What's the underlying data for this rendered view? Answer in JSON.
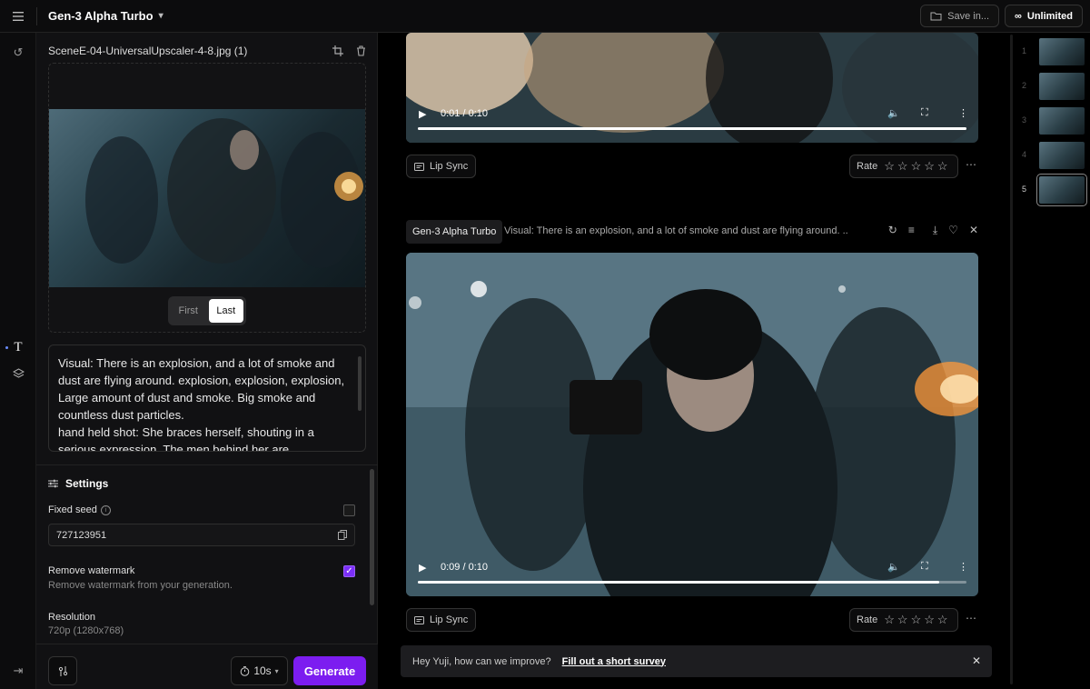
{
  "topbar": {
    "menu_icon": "hamburger-menu-icon",
    "model_name": "Gen-3 Alpha Turbo",
    "save_label": "Save in...",
    "plan_label": "Unlimited"
  },
  "panel": {
    "file_name": "SceneE-04-UniversalUpscaler-4-8.jpg (1)",
    "frame_options": [
      "First",
      "Last"
    ],
    "frame_selected": "Last",
    "prompt": "Visual: There is an explosion, and a lot of smoke and dust are flying around. explosion, explosion, explosion, Large amount of dust and smoke. Big smoke and countless dust particles.\nhand held shot: She braces herself, shouting in a serious expression. The men behind her are",
    "settings": {
      "title": "Settings",
      "fixed_seed_label": "Fixed seed",
      "fixed_seed_checked": false,
      "seed_value": "727123951",
      "watermark_label": "Remove watermark",
      "watermark_sub": "Remove watermark from your generation.",
      "watermark_checked": true,
      "resolution_label": "Resolution",
      "resolution_value": "720p (1280x768)"
    },
    "duration": "10s",
    "generate_label": "Generate"
  },
  "feed": {
    "video1": {
      "time": "0:01 / 0:10",
      "progress": 1.0
    },
    "lip_sync_label": "Lip Sync",
    "rate_label": "Rate",
    "generation": {
      "model": "Gen-3 Alpha Turbo",
      "prompt": "Visual: There is an explosion, and a lot of smoke and dust are flying around. ..."
    },
    "video2": {
      "time": "0:09 / 0:10",
      "progress": 0.95
    }
  },
  "survey": {
    "text": "Hey Yuji, how can we improve?",
    "link": "Fill out a short survey"
  },
  "thumbnails": [
    "1",
    "2",
    "3",
    "4",
    "5"
  ],
  "thumbnail_selected": "5",
  "colors": {
    "accent": "#7c1df0",
    "background": "#000000",
    "panel": "#111113"
  }
}
